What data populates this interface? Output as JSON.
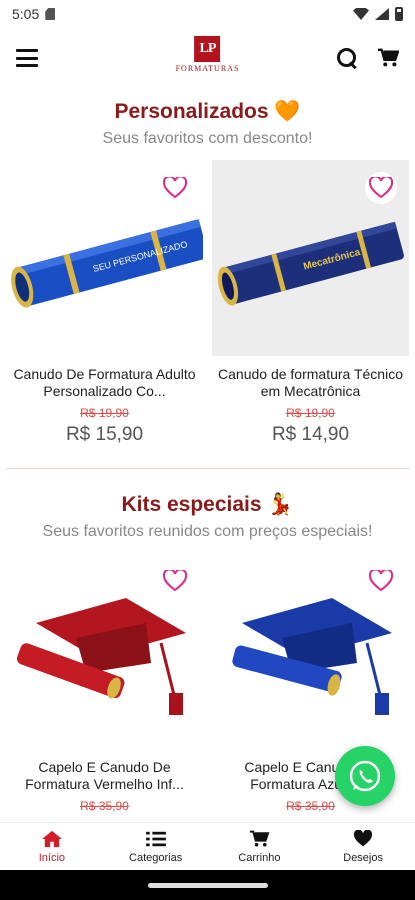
{
  "status_bar": {
    "time": "5:05"
  },
  "header": {
    "logo_mark": "LP",
    "logo_text": "FORMATURAS"
  },
  "sections": [
    {
      "title": "Personalizados 🧡",
      "subtitle": "Seus favoritos com desconto!",
      "products": [
        {
          "name": "Canudo De Formatura Adulto Personalizado Co...",
          "old_price": "R$ 19,90",
          "new_price": "R$  15,90",
          "image": "blue-diploma-tube",
          "tube_color": "#1a4fc4"
        },
        {
          "name": "Canudo de formatura Técnico em Mecatrônica",
          "old_price": "R$ 19,90",
          "new_price": "R$  14,90",
          "image": "navy-diploma-tube",
          "tube_color": "#1d2f7a"
        }
      ]
    },
    {
      "title": "Kits especiais 💃",
      "subtitle": "Seus favoritos reunidos com preços especiais!",
      "products": [
        {
          "name": "Capelo E Canudo De Formatura Vermelho Inf...",
          "old_price": "R$ 35,90",
          "image": "red-cap-and-tube",
          "cap_color": "#b3161f"
        },
        {
          "name": "Capelo E Canudo De Formatura Azul R...",
          "old_price": "R$ 35,90",
          "image": "blue-cap-and-tube",
          "cap_color": "#1a3aa8"
        }
      ]
    }
  ],
  "bottom_nav": {
    "items": [
      {
        "label": "Início",
        "icon": "home-icon"
      },
      {
        "label": "Categorias",
        "icon": "list-icon"
      },
      {
        "label": "Carrinho",
        "icon": "cart-icon"
      },
      {
        "label": "Desejos",
        "icon": "heart-icon"
      }
    ]
  },
  "colors": {
    "brand": "#8b1a1a",
    "accent": "#d11d2a",
    "heart": "#e6248a",
    "whatsapp": "#25d366"
  }
}
